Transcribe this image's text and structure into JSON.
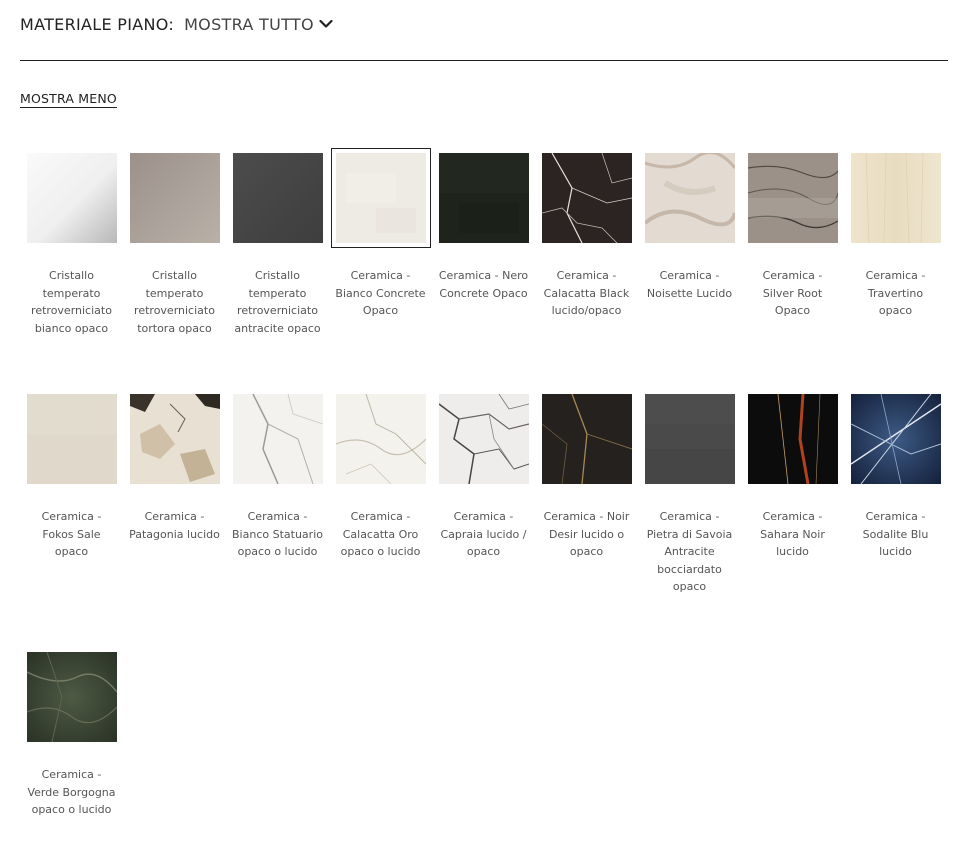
{
  "filter": {
    "label": "MATERIALE PIANO:",
    "selected": "MOSTRA TUTTO",
    "chevron_icon": "chevron-down-icon"
  },
  "toggle": {
    "label": "MOSTRA MENO"
  },
  "materials": [
    {
      "name": "Cristallo temperato retroverniciato bianco opaco",
      "swatch": "white-glass"
    },
    {
      "name": "Cristallo temperato retroverniciato tortora opaco",
      "swatch": "taupe-glass"
    },
    {
      "name": "Cristallo temperato retroverniciato antracite opaco",
      "swatch": "anthracite-glass"
    },
    {
      "name": "Ceramica - Bianco Concrete Opaco",
      "swatch": "white-concrete",
      "selected": true
    },
    {
      "name": "Ceramica - Nero Concrete Opaco",
      "swatch": "black-concrete"
    },
    {
      "name": "Ceramica - Calacatta Black lucido/opaco",
      "swatch": "calacatta-black"
    },
    {
      "name": "Ceramica - Noisette Lucido",
      "swatch": "noisette"
    },
    {
      "name": "Ceramica - Silver Root Opaco",
      "swatch": "silver-root"
    },
    {
      "name": "Ceramica - Travertino opaco",
      "swatch": "travertino"
    },
    {
      "name": "Ceramica - Fokos Sale opaco",
      "swatch": "fokos-sale"
    },
    {
      "name": "Ceramica - Patagonia lucido",
      "swatch": "patagonia"
    },
    {
      "name": "Ceramica - Bianco Statuario opaco o lucido",
      "swatch": "statuario"
    },
    {
      "name": "Ceramica - Calacatta Oro opaco o lucido",
      "swatch": "calacatta-oro"
    },
    {
      "name": "Ceramica - Capraia lucido / opaco",
      "swatch": "capraia"
    },
    {
      "name": "Ceramica - Noir Desir lucido o opaco",
      "swatch": "noir-desir"
    },
    {
      "name": "Ceramica - Pietra di Savoia Antracite bocciardato opaco",
      "swatch": "pietra-savoia"
    },
    {
      "name": "Ceramica - Sahara Noir lucido",
      "swatch": "sahara-noir"
    },
    {
      "name": "Ceramica - Sodalite Blu lucido",
      "swatch": "sodalite-blu"
    },
    {
      "name": "Ceramica - Verde Borgogna opaco o lucido",
      "swatch": "verde-borgogna"
    }
  ]
}
